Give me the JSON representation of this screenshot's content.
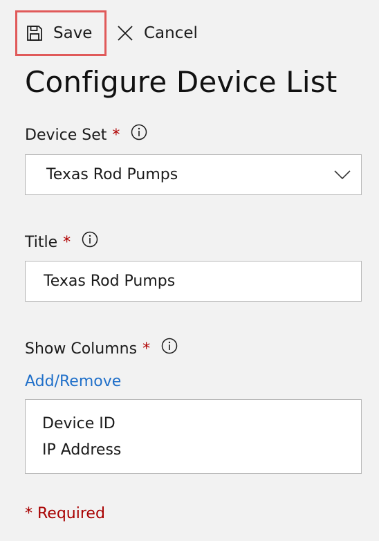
{
  "toolbar": {
    "save_label": "Save",
    "cancel_label": "Cancel"
  },
  "page_title": "Configure Device List",
  "device_set": {
    "label": "Device Set",
    "required_mark": "*",
    "selected_value": "Texas Rod Pumps"
  },
  "title_field": {
    "label": "Title",
    "required_mark": "*",
    "value": "Texas Rod Pumps"
  },
  "show_columns": {
    "label": "Show Columns",
    "required_mark": "*",
    "link_label": "Add/Remove",
    "columns": [
      "Device ID",
      "IP Address"
    ]
  },
  "required_note": "* Required",
  "colors": {
    "save_highlight_border": "#e05a5a",
    "link": "#1f6fc9",
    "required": "#a80000"
  },
  "icons": {
    "save": "save-icon",
    "cancel": "close-icon",
    "info": "info-icon",
    "dropdown": "chevron-down-icon"
  }
}
